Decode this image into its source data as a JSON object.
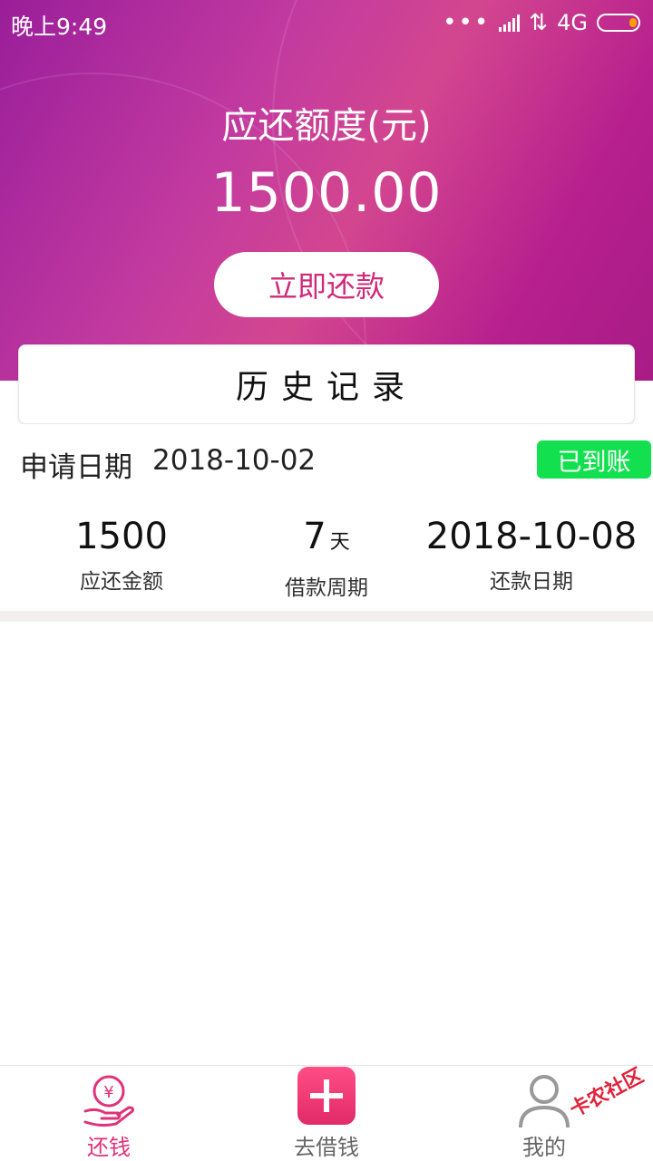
{
  "status_bar": {
    "time": "晚上9:49",
    "network": "4G"
  },
  "hero": {
    "label": "应还额度(元)",
    "amount": "1500.00",
    "repay_button": "立即还款"
  },
  "history_title": "历史记录",
  "record": {
    "apply_label": "申请日期",
    "apply_date": "2018-10-02",
    "status": "已到账",
    "stats": [
      {
        "value": "1500",
        "unit": "",
        "label": "应还金额"
      },
      {
        "value": "7",
        "unit": "天",
        "label": "借款周期"
      },
      {
        "value": "2018-10-08",
        "unit": "",
        "label": "还款日期"
      }
    ]
  },
  "tabs": [
    {
      "label": "还钱",
      "icon": "yen-hand-icon",
      "active": true
    },
    {
      "label": "去借钱",
      "icon": "plus-icon",
      "active": false
    },
    {
      "label": "我的",
      "icon": "user-icon",
      "active": false
    }
  ],
  "watermark": "卡农社区",
  "colors": {
    "accent": "#e0327a",
    "success": "#12e04e",
    "hero_from": "#9a1e9a",
    "hero_to": "#d3468f"
  }
}
